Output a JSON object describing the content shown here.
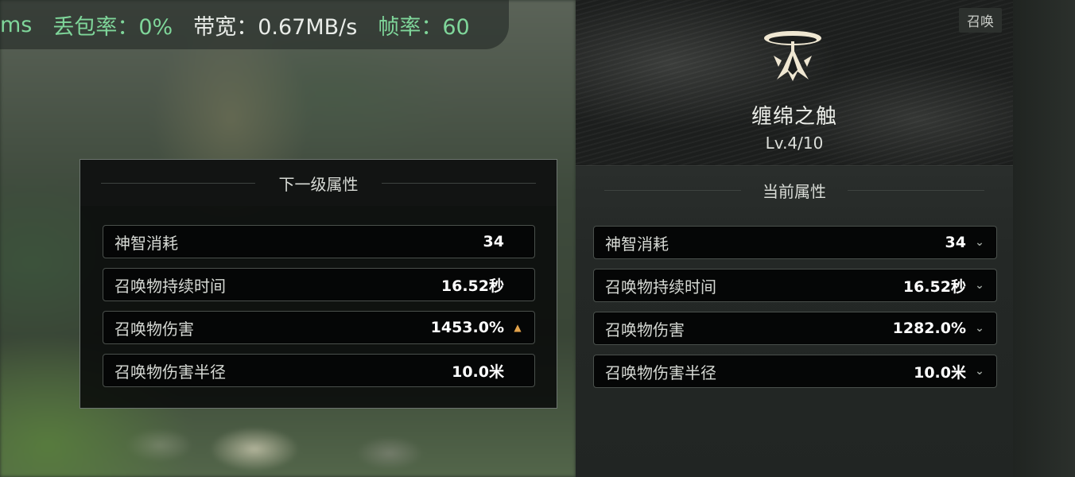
{
  "stats": {
    "prefix": "ms",
    "loss_label": "丢包率：0%",
    "bandwidth_label": "带宽：0.67MB/s",
    "fps_label": "帧率：60"
  },
  "next_level": {
    "title": "下一级属性",
    "rows": [
      {
        "label": "神智消耗",
        "value": "34",
        "trend": "none"
      },
      {
        "label": "召唤物持续时间",
        "value": "16.52秒",
        "trend": "none"
      },
      {
        "label": "召唤物伤害",
        "value": "1453.0%",
        "trend": "up"
      },
      {
        "label": "召唤物伤害半径",
        "value": "10.0米",
        "trend": "none"
      }
    ]
  },
  "skill": {
    "tag": "召唤",
    "name": "缠绵之触",
    "level": "Lv.4/10",
    "icon": "summon-crest-icon"
  },
  "current": {
    "title": "当前属性",
    "rows": [
      {
        "label": "神智消耗",
        "value": "34"
      },
      {
        "label": "召唤物持续时间",
        "value": "16.52秒"
      },
      {
        "label": "召唤物伤害",
        "value": "1282.0%"
      },
      {
        "label": "召唤物伤害半径",
        "value": "10.0米"
      }
    ]
  },
  "colors": {
    "accent_green": "#7fd69a",
    "up_arrow": "#e3a34b"
  }
}
